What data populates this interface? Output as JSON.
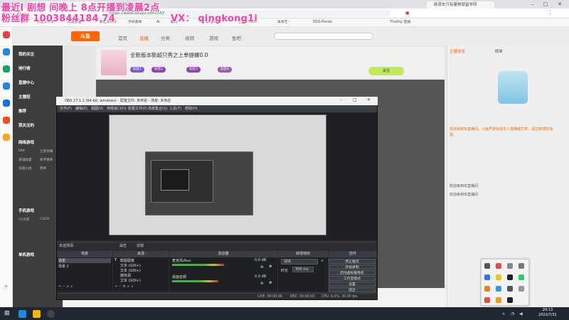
{
  "browser": {
    "tabs": [
      "",
      "新浪车只有量物就留学所"
    ],
    "url": "https://www.douyu.com/537",
    "bookmarks": [
      "书签",
      "新建文件夹",
      "网络管理",
      "新建文件夹",
      "手机看球",
      "AI",
      "剧场",
      "xx qingkong",
      "王牌 - Sum",
      "爱奇艺",
      "EDG-Panda",
      "Thaithy 直播"
    ]
  },
  "overlay": {
    "line1": "最近I 剧想 间晚上 8点开播到凌晨2点",
    "line2": "粉丝群 1003844184 74",
    "wx": "VX：  qingkong1i"
  },
  "site": {
    "logo": "斗鱼",
    "nav": [
      "首页",
      "直播",
      "分类",
      "视频",
      "游戏",
      "鱼吧"
    ],
    "search_placeholder": "",
    "sidebar_heads": [
      "我的关注",
      "排行榜",
      "直播中心",
      "主播招",
      "推荐",
      "我关注的",
      "网络游戏",
      "手机游戏",
      "单机游戏"
    ],
    "sidebar_items": [
      "DNF",
      "王者荣耀",
      "英雄联盟",
      "和平精英",
      "穿越火线",
      "原神",
      "CF手游",
      "CSGO"
    ],
    "room_title": "全新版本新超只秀之上单提螺0.0",
    "badges": [
      "标签1",
      "标签2",
      "标签3",
      "标签4"
    ],
    "follow": "关注",
    "right_tabs": [
      "主播信息",
      "榜单"
    ],
    "chat_notice": "欢迎来到本直播间，斗鱼严禁未成年人直播或打赏，请注意理性消费。",
    "chat_lines": [
      "欢迎来到本直播间",
      "欢迎来到本直播间"
    ]
  },
  "obs": {
    "title": "OBS 27.1.1 (64-bit, windows) - 配置文件: 未命名 - 场景: 未命名",
    "menu": [
      "文件(F)",
      "编辑(E)",
      "视图(V)",
      "停靠窗口(D)",
      "配置文件(P)",
      "场景集合(S)",
      "工具(T)",
      "帮助(H)"
    ],
    "no_source": "未选择源",
    "toolbar": [
      "属性",
      "滤镜"
    ],
    "docks": [
      "场景",
      "来源",
      "混音器",
      "转场特效",
      "控件"
    ],
    "scenes": [
      "场景",
      "场景 2"
    ],
    "sources": [
      "截图图像",
      "文本 (GDI+)",
      "文本 (GDI+)",
      "媒体源",
      "文本 (GDI+)"
    ],
    "mixer": [
      {
        "name": "麦克风/Aux",
        "db": "0.0 dB",
        "level": 0.62
      },
      {
        "name": "桌面音频",
        "db": "0.0 dB",
        "level": 0.55
      }
    ],
    "transition": {
      "type": "淡出",
      "duration_label": "时长",
      "duration": "300 ms"
    },
    "controls": [
      "停止推流",
      "开始录制",
      "启动虚拟摄像机",
      "工作室模式",
      "设置",
      "退出"
    ],
    "status": {
      "live": "LIVE: 00:00:00",
      "rec": "REC: 00:00:00",
      "cpu": "CPU: 6.0%, 30.00 fps"
    }
  },
  "taskbar": {
    "time": "20:13",
    "date": "2022/7/31"
  }
}
